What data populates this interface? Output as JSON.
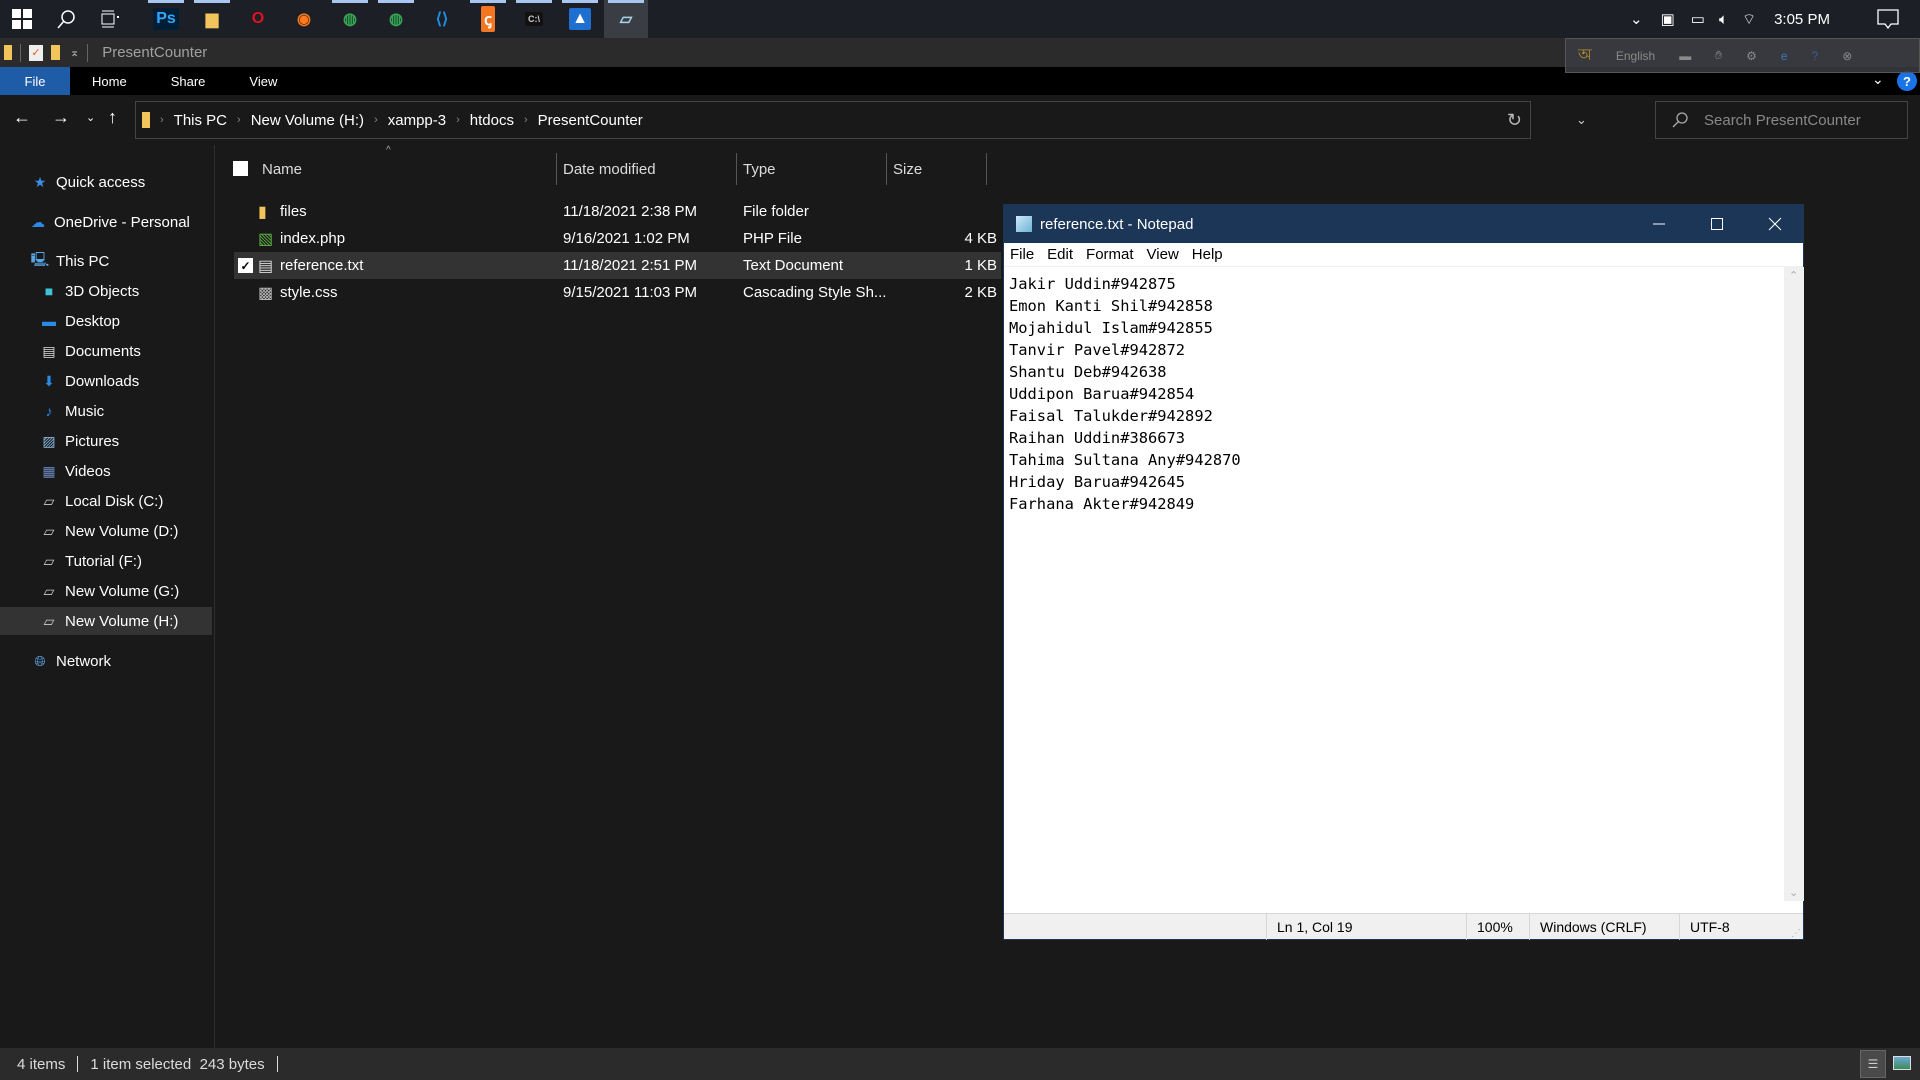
{
  "taskbar": {
    "apps": [
      {
        "name": "photoshop",
        "glyph": "Ps",
        "running": true
      },
      {
        "name": "file-explorer",
        "glyph": "▆",
        "running": true
      },
      {
        "name": "opera",
        "glyph": "O",
        "running": false
      },
      {
        "name": "firefox",
        "glyph": "◉",
        "running": false
      },
      {
        "name": "chrome-profile",
        "glyph": "◍",
        "running": true
      },
      {
        "name": "chrome",
        "glyph": "◍",
        "running": true
      },
      {
        "name": "vscode",
        "glyph": "⟨⟩",
        "running": false
      },
      {
        "name": "xampp",
        "glyph": "ꞔ",
        "running": true
      },
      {
        "name": "terminal",
        "glyph": "C:\\",
        "running": true
      },
      {
        "name": "photos",
        "glyph": "▲",
        "running": true
      },
      {
        "name": "notepad",
        "glyph": "▱",
        "running": true
      }
    ],
    "clock": "3:05 PM"
  },
  "langbar": {
    "language": "English"
  },
  "explorer": {
    "window_title": "PresentCounter",
    "ribbon_tabs": [
      "File",
      "Home",
      "Share",
      "View"
    ],
    "breadcrumb": [
      "This PC",
      "New Volume (H:)",
      "xampp-3",
      "htdocs",
      "PresentCounter"
    ],
    "search_placeholder": "Search PresentCounter",
    "sidebar": {
      "quick_access": "Quick access",
      "onedrive": "OneDrive - Personal",
      "this_pc": "This PC",
      "items": [
        {
          "label": "3D Objects",
          "icon": "cube"
        },
        {
          "label": "Desktop",
          "icon": "desktop"
        },
        {
          "label": "Documents",
          "icon": "document"
        },
        {
          "label": "Downloads",
          "icon": "download"
        },
        {
          "label": "Music",
          "icon": "music"
        },
        {
          "label": "Pictures",
          "icon": "pictures"
        },
        {
          "label": "Videos",
          "icon": "videos"
        },
        {
          "label": "Local Disk (C:)",
          "icon": "drive"
        },
        {
          "label": "New Volume (D:)",
          "icon": "drive"
        },
        {
          "label": "Tutorial (F:)",
          "icon": "drive"
        },
        {
          "label": "New Volume (G:)",
          "icon": "drive"
        },
        {
          "label": "New Volume (H:)",
          "icon": "drive",
          "selected": true
        }
      ],
      "network": "Network"
    },
    "columns": {
      "name": "Name",
      "date": "Date modified",
      "type": "Type",
      "size": "Size"
    },
    "files": [
      {
        "name": "files",
        "date": "11/18/2021 2:38 PM",
        "type": "File folder",
        "size": "",
        "icon": "folder",
        "selected": false
      },
      {
        "name": "index.php",
        "date": "9/16/2021 1:02 PM",
        "type": "PHP File",
        "size": "4 KB",
        "icon": "php",
        "selected": false
      },
      {
        "name": "reference.txt",
        "date": "11/18/2021 2:51 PM",
        "type": "Text Document",
        "size": "1 KB",
        "icon": "text",
        "selected": true
      },
      {
        "name": "style.css",
        "date": "9/15/2021 11:03 PM",
        "type": "Cascading Style Sh...",
        "size": "2 KB",
        "icon": "css",
        "selected": false
      }
    ],
    "status": {
      "items": "4 items",
      "selected": "1 item selected  243 bytes"
    }
  },
  "notepad": {
    "title": "reference.txt - Notepad",
    "menu": [
      "File",
      "Edit",
      "Format",
      "View",
      "Help"
    ],
    "lines": [
      "Jakir Uddin#942875",
      "Emon Kanti Shil#942858",
      "Mojahidul Islam#942855",
      "Tanvir Pavel#942872",
      "Shantu Deb#942638",
      "Uddipon Barua#942854",
      "Faisal Talukder#942892",
      "Raihan Uddin#386673",
      "Tahima Sultana Any#942870",
      "Hriday Barua#942645",
      "Farhana Akter#942849"
    ],
    "status": {
      "position": "Ln 1, Col 19",
      "zoom": "100%",
      "line_ending": "Windows (CRLF)",
      "encoding": "UTF-8"
    }
  }
}
